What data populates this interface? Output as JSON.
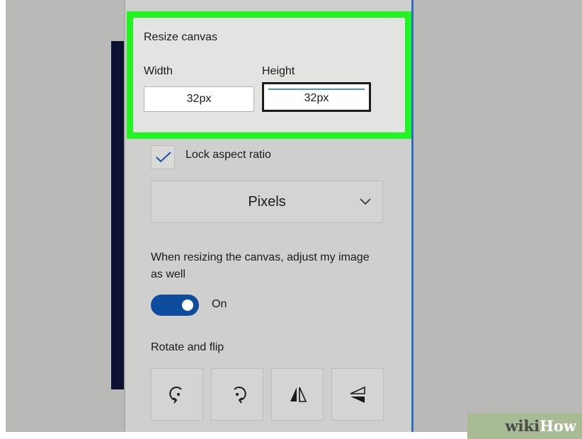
{
  "resize_canvas": {
    "title": "Resize canvas",
    "width_label": "Width",
    "height_label": "Height",
    "width_value": "32px",
    "height_value": "32px"
  },
  "lock_aspect": {
    "label": "Lock aspect ratio",
    "checked": true
  },
  "units_dropdown": {
    "selected": "Pixels"
  },
  "resize_image": {
    "description": "When resizing the canvas, adjust my image as well",
    "toggle_label": "On",
    "toggle_on": true
  },
  "rotate_flip": {
    "title": "Rotate and flip",
    "buttons": [
      {
        "icon": "rotate-left-icon"
      },
      {
        "icon": "rotate-right-icon"
      },
      {
        "icon": "flip-horizontal-icon"
      },
      {
        "icon": "flip-vertical-icon"
      }
    ]
  },
  "watermark": {
    "part_a": "wiki",
    "part_b": "How"
  },
  "colors": {
    "highlight": "#21f521",
    "accent": "#0e4c9e",
    "focus_underline": "#4a90d9"
  }
}
